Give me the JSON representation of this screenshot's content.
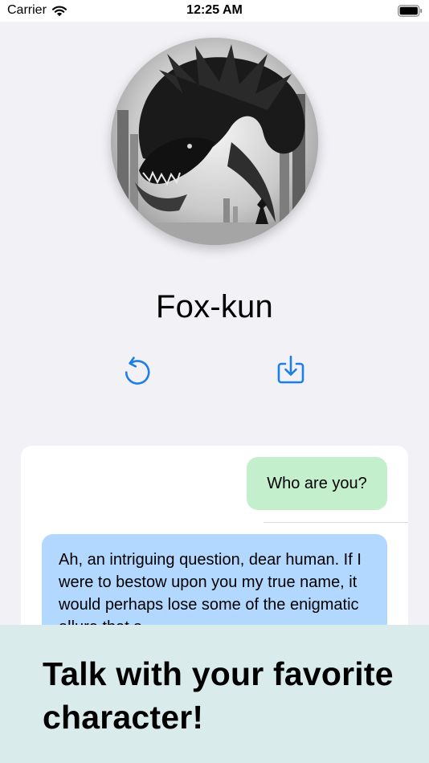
{
  "status_bar": {
    "carrier": "Carrier",
    "time": "12:25 AM",
    "wifi_icon": "wifi-icon",
    "battery_icon": "battery-icon"
  },
  "character": {
    "name": "Fox-kun"
  },
  "actions": {
    "reset_icon": "arrow-counterclockwise-icon",
    "save_icon": "tray-download-icon"
  },
  "chat": {
    "messages": [
      {
        "role": "user",
        "text": "Who are you?"
      },
      {
        "role": "assistant",
        "text": "Ah, an intriguing question, dear human. If I were to bestow upon you my true name, it would perhaps lose some of the enigmatic allure that s..."
      }
    ]
  },
  "promo": {
    "headline": "Talk with your favorite character!"
  },
  "colors": {
    "accent": "#1a7fe8",
    "user_bubble": "#c3efcd",
    "assistant_bubble": "#b3d8ff",
    "banner": "#d9ebea",
    "background": "#f2f1f6"
  }
}
